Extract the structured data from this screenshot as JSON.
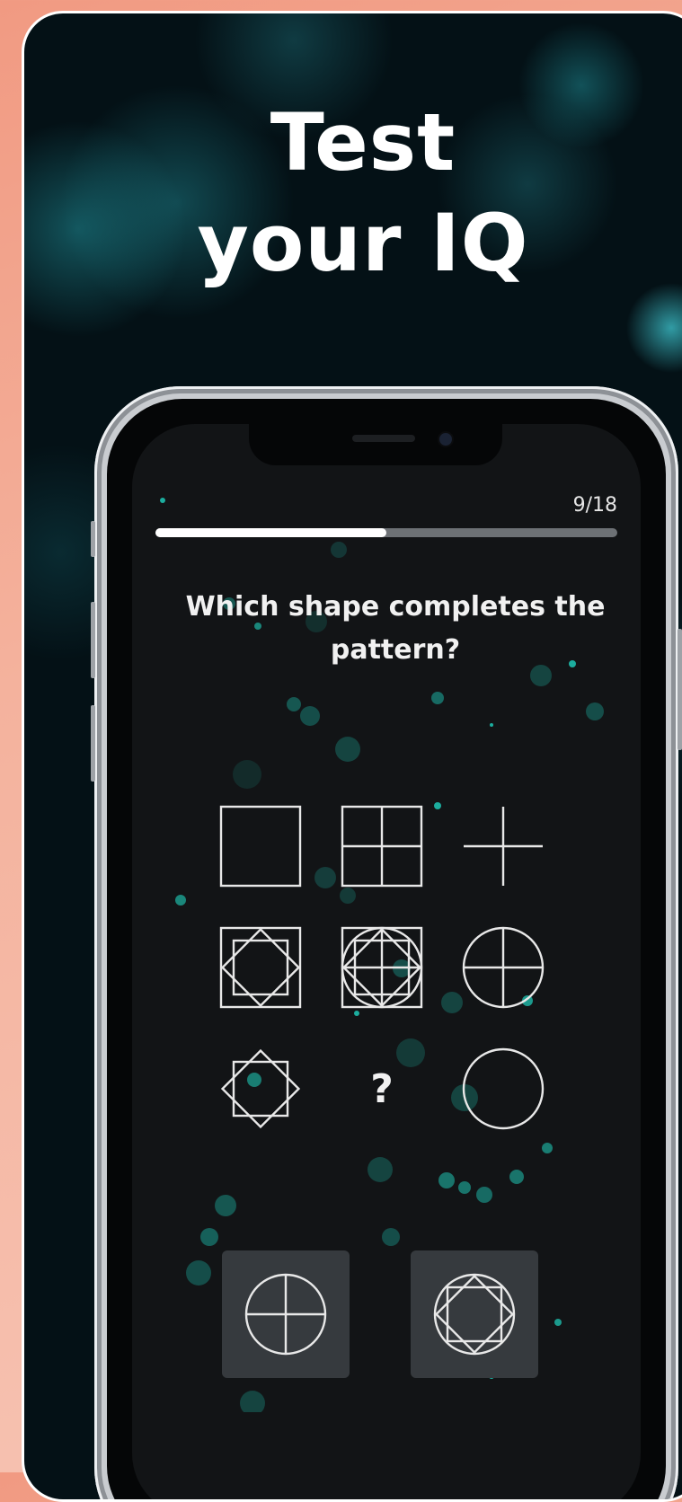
{
  "headline": {
    "line1": "Test",
    "line2": "your IQ"
  },
  "quiz": {
    "counter": "9/18",
    "progress_fraction": 0.5,
    "question": "Which shape completes the pattern?",
    "grid": [
      [
        "square-icon",
        "square-quartered-icon",
        "plus-icon"
      ],
      [
        "square-with-star-icon",
        "square-star-circle-cross-icon",
        "circle-cross-icon"
      ],
      [
        "eight-point-star-icon",
        "missing",
        "circle-icon"
      ]
    ],
    "missing_label": "?",
    "options": [
      "circle-cross-icon",
      "circle-star-icon"
    ]
  },
  "colors": {
    "background_accent": "#f19a82",
    "screen": "#121416",
    "particle": "#1fd3c0",
    "option_tile": "#363a3e"
  }
}
